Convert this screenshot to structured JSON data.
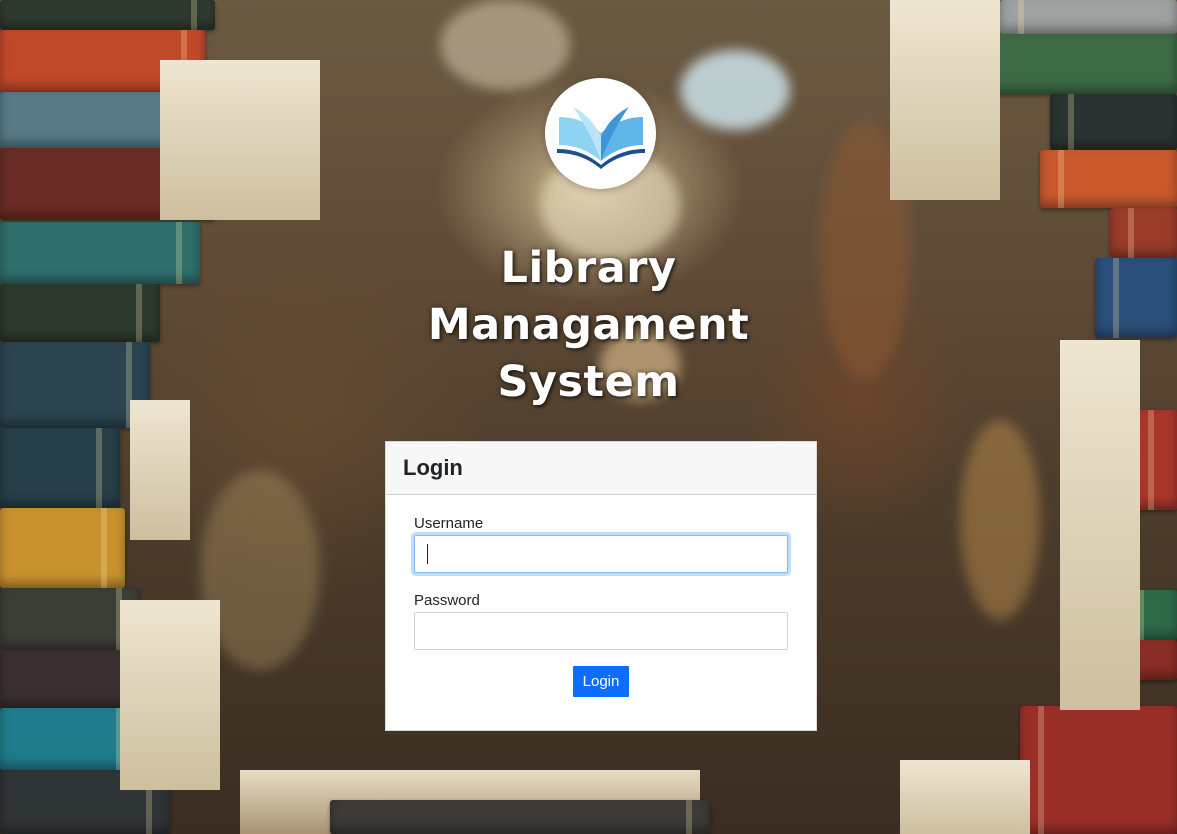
{
  "app": {
    "title": "Library Managament System"
  },
  "login": {
    "heading": "Login",
    "username_label": "Username",
    "username_value": "",
    "password_label": "Password",
    "password_value": "",
    "submit_label": "Login"
  },
  "icons": {
    "logo": "open-book-icon"
  },
  "colors": {
    "primary": "#0d6efd",
    "focus_ring": "#80bdff",
    "card_header_bg": "#f7f7f7",
    "logo_blue_light": "#8fd3f4",
    "logo_blue_dark": "#1f4e8c"
  }
}
